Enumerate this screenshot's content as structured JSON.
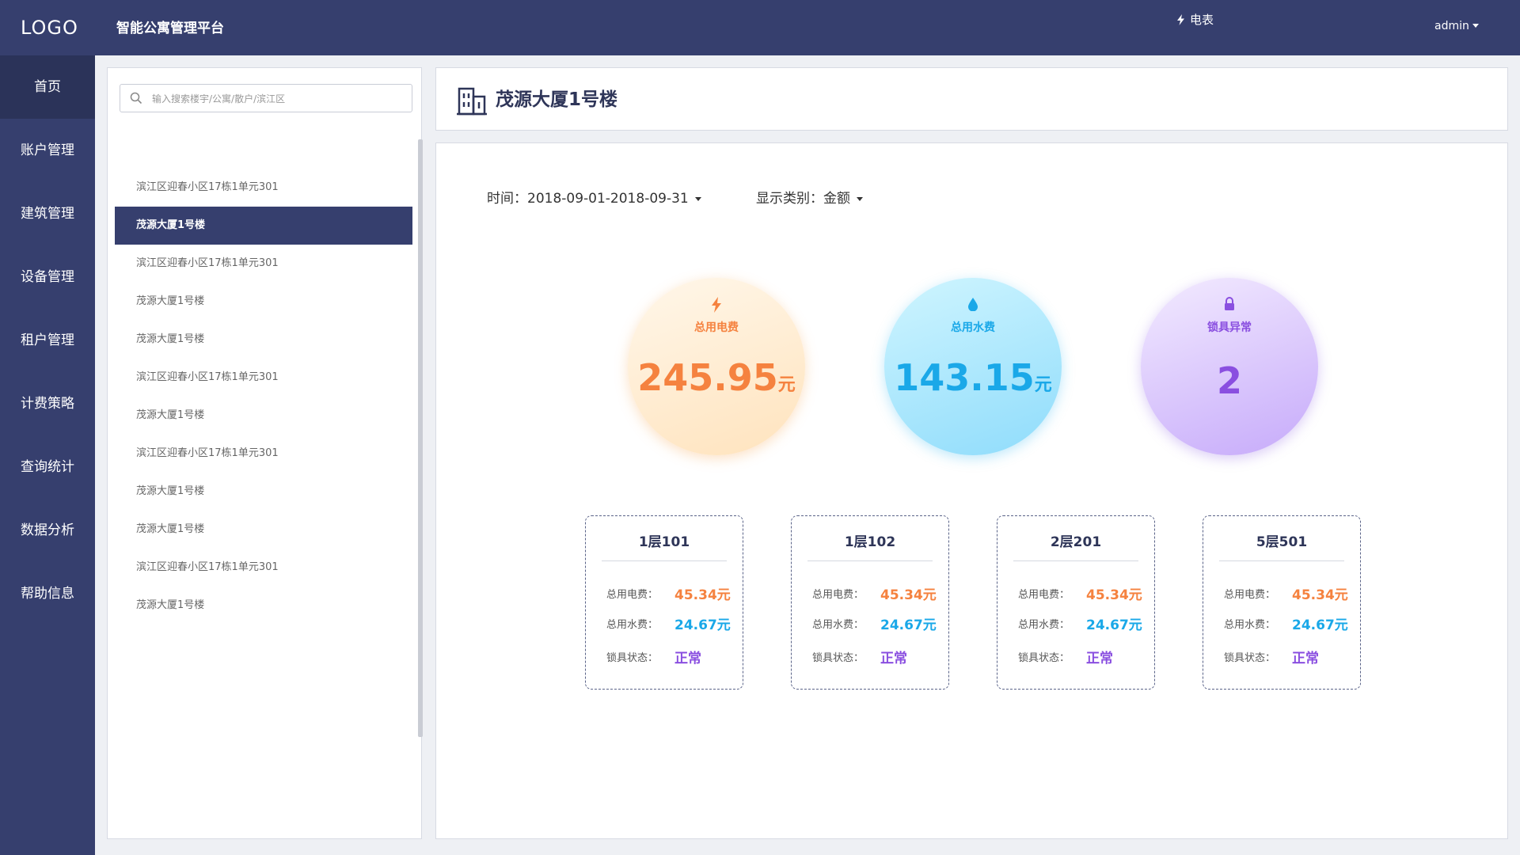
{
  "app": {
    "logo": "LOGO",
    "title": "智能公寓管理平台",
    "meter_label": "电表",
    "user": "admin"
  },
  "nav": [
    {
      "label": "首页",
      "active": true
    },
    {
      "label": "账户管理"
    },
    {
      "label": "建筑管理"
    },
    {
      "label": "设备管理"
    },
    {
      "label": "租户管理"
    },
    {
      "label": "计费策略"
    },
    {
      "label": "查询统计"
    },
    {
      "label": "数据分析"
    },
    {
      "label": "帮助信息"
    }
  ],
  "search": {
    "placeholder": "输入搜索楼宇/公寓/散户/滨江区",
    "value": ""
  },
  "tree": [
    {
      "label": "滨江区迎春小区17栋1单元301"
    },
    {
      "label": "茂源大厦1号楼",
      "selected": true
    },
    {
      "label": "滨江区迎春小区17栋1单元301"
    },
    {
      "label": "茂源大厦1号楼"
    },
    {
      "label": "茂源大厦1号楼"
    },
    {
      "label": "滨江区迎春小区17栋1单元301"
    },
    {
      "label": "茂源大厦1号楼"
    },
    {
      "label": "滨江区迎春小区17栋1单元301"
    },
    {
      "label": "茂源大厦1号楼"
    },
    {
      "label": "茂源大厦1号楼"
    },
    {
      "label": "滨江区迎春小区17栋1单元301"
    },
    {
      "label": "茂源大厦1号楼"
    }
  ],
  "building": {
    "name": "茂源大厦1号楼"
  },
  "filters": {
    "time_label": "时间：",
    "time_value": "2018-09-01-2018-09-31",
    "type_label": "显示类别：",
    "type_value": "金额"
  },
  "summary": {
    "electricity": {
      "label": "总用电费",
      "value": "245.95",
      "unit": "元",
      "color": "#f5823f",
      "icon": "lightning-icon"
    },
    "water": {
      "label": "总用水费",
      "value": "143.15",
      "unit": "元",
      "color": "#1aa8e8",
      "icon": "water-drop-icon"
    },
    "lock": {
      "label": "锁具异常",
      "value": "2",
      "color": "#8a4fe0",
      "icon": "lock-icon"
    }
  },
  "rooms": [
    {
      "name": "1层101",
      "elec_label": "总用电费：",
      "elec": "45.34元",
      "water_label": "总用水费：",
      "water": "24.67元",
      "lock_label": "锁具状态：",
      "lock": "正常"
    },
    {
      "name": "1层102",
      "elec_label": "总用电费：",
      "elec": "45.34元",
      "water_label": "总用水费：",
      "water": "24.67元",
      "lock_label": "锁具状态：",
      "lock": "正常"
    },
    {
      "name": "2层201",
      "elec_label": "总用电费：",
      "elec": "45.34元",
      "water_label": "总用水费：",
      "water": "24.67元",
      "lock_label": "锁具状态：",
      "lock": "正常"
    },
    {
      "name": "5层501",
      "elec_label": "总用电费：",
      "elec": "45.34元",
      "water_label": "总用水费：",
      "water": "24.67元",
      "lock_label": "锁具状态：",
      "lock": "正常"
    }
  ],
  "colors": {
    "primary": "#363f6e",
    "elec": "#f5823f",
    "water": "#1aa8e8",
    "lock": "#8a4fe0"
  }
}
